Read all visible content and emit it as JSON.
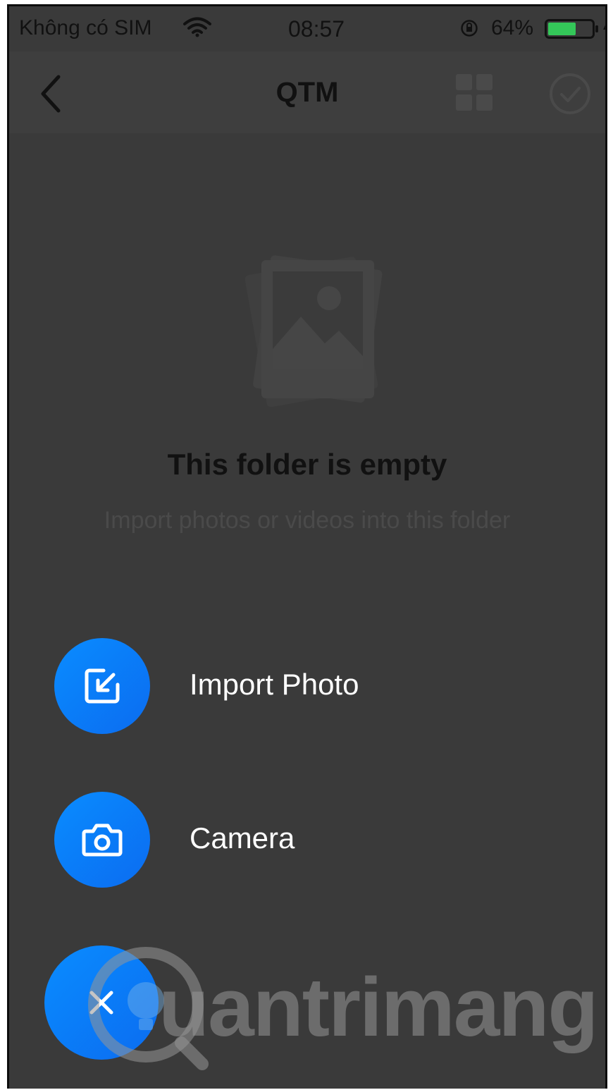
{
  "status_bar": {
    "carrier": "Không có SIM",
    "time": "08:57",
    "battery_percent": "64%",
    "battery_level": 0.64,
    "battery_color": "#34c759",
    "icons": [
      "wifi-icon",
      "orientation-lock-icon",
      "battery-icon",
      "charging-bolt-icon"
    ]
  },
  "nav": {
    "title": "QTM",
    "icons": [
      "back-chevron-icon",
      "grid-view-icon",
      "select-check-icon"
    ]
  },
  "empty_state": {
    "illustration": "photo-stack-icon",
    "title": "This folder is empty",
    "subtitle": "Import photos or videos into this folder"
  },
  "fab_menu": {
    "accent_color": "#0a84ff",
    "items": [
      {
        "label": "Import Photo",
        "icon": "import-icon"
      },
      {
        "label": "Camera",
        "icon": "camera-icon"
      }
    ],
    "close_icon": "close-icon"
  },
  "watermark": {
    "text": "uantrimang",
    "logo": "lightbulb-q-logo"
  }
}
